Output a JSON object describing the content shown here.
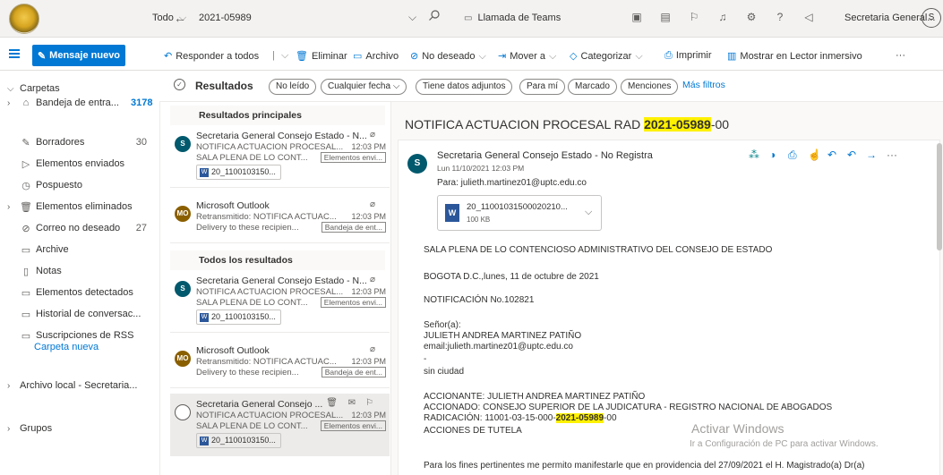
{
  "top": {
    "scope": "Todo",
    "search_query": "2021-05989",
    "teams_label": "Llamada de Teams",
    "account_label": "Secretaria General...",
    "avatar_initial": "S"
  },
  "commands": {
    "new_message": "Mensaje nuevo",
    "reply_all": "Responder a todos",
    "delete": "Eliminar",
    "archive": "Archivo",
    "junk": "No deseado",
    "move_to": "Mover a",
    "categorize": "Categorizar",
    "print": "Imprimir",
    "immersive": "Mostrar en Lector inmersivo",
    "more": "···"
  },
  "nav": {
    "folders_header": "Carpetas",
    "items": [
      {
        "label": "Bandeja de entra...",
        "count": "3178",
        "icon": "inbox-icon"
      },
      {
        "label": "Borradores",
        "count": "30",
        "icon": "draft-icon"
      },
      {
        "label": "Elementos enviados",
        "count": "",
        "icon": "sent-icon"
      },
      {
        "label": "Pospuesto",
        "count": "",
        "icon": "clock-icon"
      },
      {
        "label": "Elementos eliminados",
        "count": "",
        "icon": "trash-icon"
      },
      {
        "label": "Correo no deseado",
        "count": "27",
        "icon": "junk-icon"
      },
      {
        "label": "Archive",
        "count": "",
        "icon": "archive-icon"
      },
      {
        "label": "Notas",
        "count": "",
        "icon": "note-icon"
      },
      {
        "label": "Elementos detectados",
        "count": "",
        "icon": "folder-icon"
      },
      {
        "label": "Historial de conversac...",
        "count": "",
        "icon": "folder-icon"
      },
      {
        "label": "Suscripciones de RSS",
        "count": "",
        "icon": "folder-icon"
      }
    ],
    "new_folder": "Carpeta nueva",
    "local_archive": "Archivo local - Secretaria...",
    "groups": "Grupos"
  },
  "filters": {
    "results": "Resultados",
    "unread": "No leído",
    "any_date": "Cualquier fecha",
    "has_attachments": "Tiene datos adjuntos",
    "for_me": "Para mí",
    "flagged": "Marcado",
    "mentions": "Menciones",
    "more": "Más filtros"
  },
  "list": {
    "top_results": "Resultados principales",
    "all_results": "Todos los resultados",
    "messages": [
      {
        "sender": "Secretaria General Consejo Estado - N...",
        "subject": "NOTIFICA ACTUACION PROCESAL...",
        "time": "12:03 PM",
        "preview": "SALA PLENA DE LO CONT...",
        "tag": "Elementos envi...",
        "attachment": "20_1100103150...",
        "avatar": "S",
        "avatar_color": "#00596d"
      },
      {
        "sender": "Microsoft Outlook",
        "subject": "Retransmitido: NOTIFICA ACTUAC...",
        "time": "12:03 PM",
        "preview": "Delivery to these recipien...",
        "tag": "Bandeja de ent...",
        "attachment": "",
        "avatar": "MO",
        "avatar_color": "#8a5f00"
      },
      {
        "sender": "Secretaria General Consejo Estado - N...",
        "subject": "NOTIFICA ACTUACION PROCESAL...",
        "time": "12:03 PM",
        "preview": "SALA PLENA DE LO CONT...",
        "tag": "Elementos envi...",
        "attachment": "20_1100103150...",
        "avatar": "S",
        "avatar_color": "#00596d"
      },
      {
        "sender": "Microsoft Outlook",
        "subject": "Retransmitido: NOTIFICA ACTUAC...",
        "time": "12:03 PM",
        "preview": "Delivery to these recipien...",
        "tag": "Bandeja de ent...",
        "attachment": "",
        "avatar": "MO",
        "avatar_color": "#8a5f00"
      },
      {
        "sender": "Secretaria General Consejo ...",
        "subject": "NOTIFICA ACTUACION PROCESAL...",
        "time": "12:03 PM",
        "preview": "SALA PLENA DE LO CONT...",
        "tag": "Elementos envi...",
        "attachment": "20_1100103150...",
        "avatar": "",
        "avatar_color": ""
      }
    ]
  },
  "reading": {
    "title_prefix": "NOTIFICA ACTUACION PROCESAL RAD ",
    "title_highlight": "2021-05989",
    "title_suffix": "-00",
    "from": "Secretaria General Consejo Estado - No Registra",
    "date": "Lun 11/10/2021 12:03 PM",
    "to": "Para:  julieth.martinez01@uptc.edu.co",
    "att_name": "20_11001031500020210...",
    "att_size": "100 KB",
    "body": {
      "l1": "SALA PLENA DE LO CONTENCIOSO ADMINISTRATIVO DEL CONSEJO DE ESTADO",
      "l2": "BOGOTA D.C.,lunes, 11 de octubre de 2021",
      "l3": "NOTIFICACIÓN No.102821",
      "l4": "Señor(a):",
      "l5": "JULIETH ANDREA MARTINEZ PATIÑO",
      "l6": "email:julieth.martinez01@uptc.edu.co",
      "l7": "-",
      "l8": "sin ciudad",
      "l9": "ACCIONANTE: JULIETH ANDREA MARTINEZ PATIÑO",
      "l10": "ACCIONADO: CONSEJO SUPERIOR DE LA JUDICATURA - REGISTRO NACIONAL DE ABOGADOS",
      "l11_prefix": "RADICACIÓN: 11001-03-15-000-",
      "l11_highlight": "2021-05989",
      "l11_suffix": "-00",
      "l12": "ACCIONES DE TUTELA",
      "l13": "Para los fines pertinentes me permito manifestarle que en providencia del 27/09/2021  el H. Magistrado(a) Dr(a)"
    },
    "watermark_title": "Activar Windows",
    "watermark_sub": "Ir a Configuración de PC para activar Windows."
  }
}
